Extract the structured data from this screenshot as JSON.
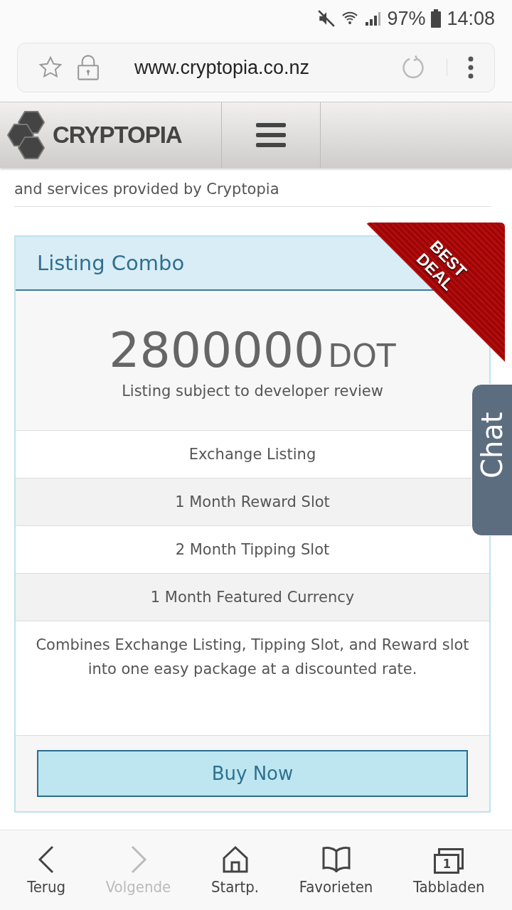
{
  "status_bar": {
    "battery": "97%",
    "time": "14:08"
  },
  "browser": {
    "url": "www.cryptopia.co.nz"
  },
  "site_header": {
    "logo": "CRYPTOPIA"
  },
  "intro": "and services provided by Cryptopia",
  "card": {
    "title": "Listing Combo",
    "ribbon": [
      "BEST",
      "DEAL"
    ],
    "price": "2800000",
    "unit": "DOT",
    "note": "Listing subject to developer review",
    "features": [
      {
        "text": "Exchange Listing",
        "shaded": false
      },
      {
        "text": "1 Month Reward Slot",
        "shaded": true
      },
      {
        "text": "2 Month Tipping Slot",
        "shaded": false
      },
      {
        "text": "1 Month Featured Currency",
        "shaded": true
      }
    ],
    "description": "Combines Exchange Listing, Tipping Slot, and Reward slot into one easy package at a discounted rate.",
    "button": "Buy Now"
  },
  "chat_tab": "Chat",
  "bottom_nav": [
    {
      "kind": "back",
      "label": "Terug",
      "disabled": false
    },
    {
      "kind": "forward",
      "label": "Volgende",
      "disabled": true
    },
    {
      "kind": "home",
      "label": "Startp.",
      "disabled": false
    },
    {
      "kind": "bookmarks",
      "label": "Favorieten",
      "disabled": false
    },
    {
      "kind": "tabs",
      "label": "Tabbladen",
      "disabled": false,
      "count": "1"
    }
  ]
}
